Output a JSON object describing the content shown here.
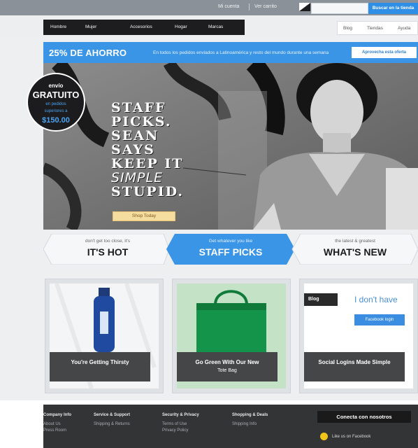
{
  "topbar": {
    "links": [
      "Mi cuenta",
      "Ver carrito"
    ],
    "search_button": "Buscar en la tienda"
  },
  "nav": {
    "items": [
      "Hombre",
      "Mujer",
      "Accesorios",
      "Hogar",
      "Marcas"
    ],
    "sub_items": [
      "Blog",
      "Tiendas",
      "Ayuda"
    ]
  },
  "promo": {
    "title": "25% DE AHORRO",
    "text": "En todos los pedidos enviados a Latinoamérica y resto del mundo durante una semana",
    "button": "Aprovecha esta oferta"
  },
  "badge": {
    "line1": "envío",
    "line2": "GRATUITO",
    "line3": "en pedidos",
    "line4": "superiores a",
    "line5": "$150.00"
  },
  "hero": {
    "headline_lines": [
      "STAFF",
      "PICKS.",
      "SEAN",
      "SAYS",
      "KEEP IT"
    ],
    "script_word": "SIMPLE",
    "last_line": "STUPID.",
    "button": "Shop Today"
  },
  "tabs": [
    {
      "sub": "don't get too close, it's",
      "main": "IT'S HOT"
    },
    {
      "sub": "Get whatever you like",
      "main": "STAFF PICKS"
    },
    {
      "sub": "the latest & greatest",
      "main": "WHAT'S NEW"
    }
  ],
  "cards": [
    {
      "caption": "You're Getting Thirsty",
      "sub": ""
    },
    {
      "caption": "Go Green With Our New",
      "sub": "Tote Bag"
    },
    {
      "caption": "Social Logins Made Simple",
      "sub": ""
    }
  ],
  "card3": {
    "tag": "Blog",
    "headline": "I don't have",
    "button": "Facebook login"
  },
  "footer": {
    "columns": [
      {
        "heading": "Company Info",
        "links": [
          "About Us",
          "Press Room"
        ]
      },
      {
        "heading": "Service & Support",
        "links": [
          "Shipping & Returns"
        ]
      },
      {
        "heading": "Security & Privacy",
        "links": [
          "Terms of Use",
          "Privacy Policy"
        ]
      },
      {
        "heading": "Shopping & Deals",
        "links": [
          "Shipping Info"
        ]
      }
    ],
    "connect": "Conecta con nosotros",
    "facebook": "Like us on Facebook"
  },
  "colors": {
    "accent": "#3a95e6",
    "dark": "#1d1d1f",
    "footer": "#323436"
  }
}
